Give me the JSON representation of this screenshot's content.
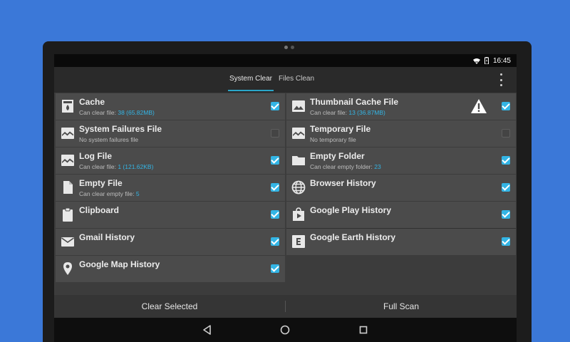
{
  "status": {
    "time": "16:45"
  },
  "tabs": [
    "System Clear",
    "Files Clean"
  ],
  "colors": {
    "accent": "#33b5e5",
    "background": "#3b78d8"
  },
  "items": [
    {
      "title": "Cache",
      "sub_prefix": "Can clear file: ",
      "sub_value": "38 (65.82MB)",
      "checked": true,
      "icon": "cache-icon"
    },
    {
      "title": "Thumbnail Cache File",
      "sub_prefix": "Can clear file: ",
      "sub_value": "13 (36.87MB)",
      "checked": true,
      "icon": "image-icon",
      "warning": true
    },
    {
      "title": "System Failures File",
      "sub_prefix": "No system failures file",
      "sub_value": "",
      "checked": false,
      "icon": "broken-image-icon"
    },
    {
      "title": "Temporary File",
      "sub_prefix": "No temporary file",
      "sub_value": "",
      "checked": false,
      "icon": "broken-image-icon"
    },
    {
      "title": "Log File",
      "sub_prefix": "Can clear file: ",
      "sub_value": "1 (121.62KB)",
      "checked": true,
      "icon": "broken-image-icon"
    },
    {
      "title": "Empty Folder",
      "sub_prefix": "Can clear empty folder: ",
      "sub_value": "23",
      "checked": true,
      "icon": "folder-icon"
    },
    {
      "title": "Empty File",
      "sub_prefix": "Can clear empty file: ",
      "sub_value": "5",
      "checked": true,
      "icon": "file-icon"
    },
    {
      "title": "Browser History",
      "sub_prefix": "",
      "sub_value": "",
      "checked": true,
      "icon": "globe-icon"
    },
    {
      "title": "Clipboard",
      "sub_prefix": "",
      "sub_value": "",
      "checked": true,
      "icon": "clipboard-icon"
    },
    {
      "title": "Google Play History",
      "sub_prefix": "",
      "sub_value": "",
      "checked": true,
      "icon": "play-store-icon"
    },
    {
      "title": "Gmail History",
      "sub_prefix": "",
      "sub_value": "",
      "checked": true,
      "icon": "mail-icon"
    },
    {
      "title": "Google Earth History",
      "sub_prefix": "",
      "sub_value": "",
      "checked": true,
      "icon": "earth-e-icon"
    },
    {
      "title": "Google Map History",
      "sub_prefix": "",
      "sub_value": "",
      "checked": true,
      "icon": "map-pin-icon"
    }
  ],
  "actions": {
    "clear_selected": "Clear Selected",
    "full_scan": "Full Scan"
  }
}
